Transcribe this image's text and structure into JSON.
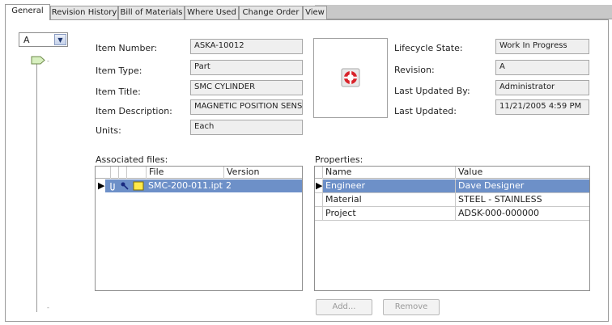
{
  "tabs": [
    {
      "label": "General"
    },
    {
      "label": "Revision History"
    },
    {
      "label": "Bill of Materials"
    },
    {
      "label": "Where Used"
    },
    {
      "label": "Change Order"
    },
    {
      "label": "View"
    }
  ],
  "revision_selector": {
    "value": "A"
  },
  "fields": {
    "item_number": {
      "label": "Item Number:",
      "value": "ASKA-10012"
    },
    "item_type": {
      "label": "Item Type:",
      "value": "Part"
    },
    "item_title": {
      "label": "Item Title:",
      "value": "SMC CYLINDER"
    },
    "item_description": {
      "label": "Item Description:",
      "value": "MAGNETIC POSITION SENS("
    },
    "units": {
      "label": "Units:",
      "value": "Each"
    },
    "lifecycle_state": {
      "label": "Lifecycle State:",
      "value": "Work In Progress"
    },
    "revision": {
      "label": "Revision:",
      "value": "A"
    },
    "last_updated_by": {
      "label": "Last Updated By:",
      "value": "Administrator"
    },
    "last_updated": {
      "label": "Last Updated:",
      "value": "11/21/2005 4:59 PM"
    }
  },
  "associated_files": {
    "title": "Associated files:",
    "columns": {
      "file": "File",
      "version": "Version"
    },
    "rows": [
      {
        "file": "SMC-200-011.ipt",
        "version": "2"
      }
    ]
  },
  "properties": {
    "title": "Properties:",
    "columns": {
      "name": "Name",
      "value": "Value"
    },
    "rows": [
      {
        "name": "Engineer",
        "value": "Dave Designer"
      },
      {
        "name": "Material",
        "value": "STEEL - STAINLESS"
      },
      {
        "name": "Project",
        "value": "ADSK-000-000000"
      }
    ]
  },
  "buttons": {
    "add": "Add...",
    "remove": "Remove"
  },
  "colors": {
    "selection": "#6d90c8",
    "tab_strip": "#c8c8c8",
    "field_bg": "#efefef"
  }
}
